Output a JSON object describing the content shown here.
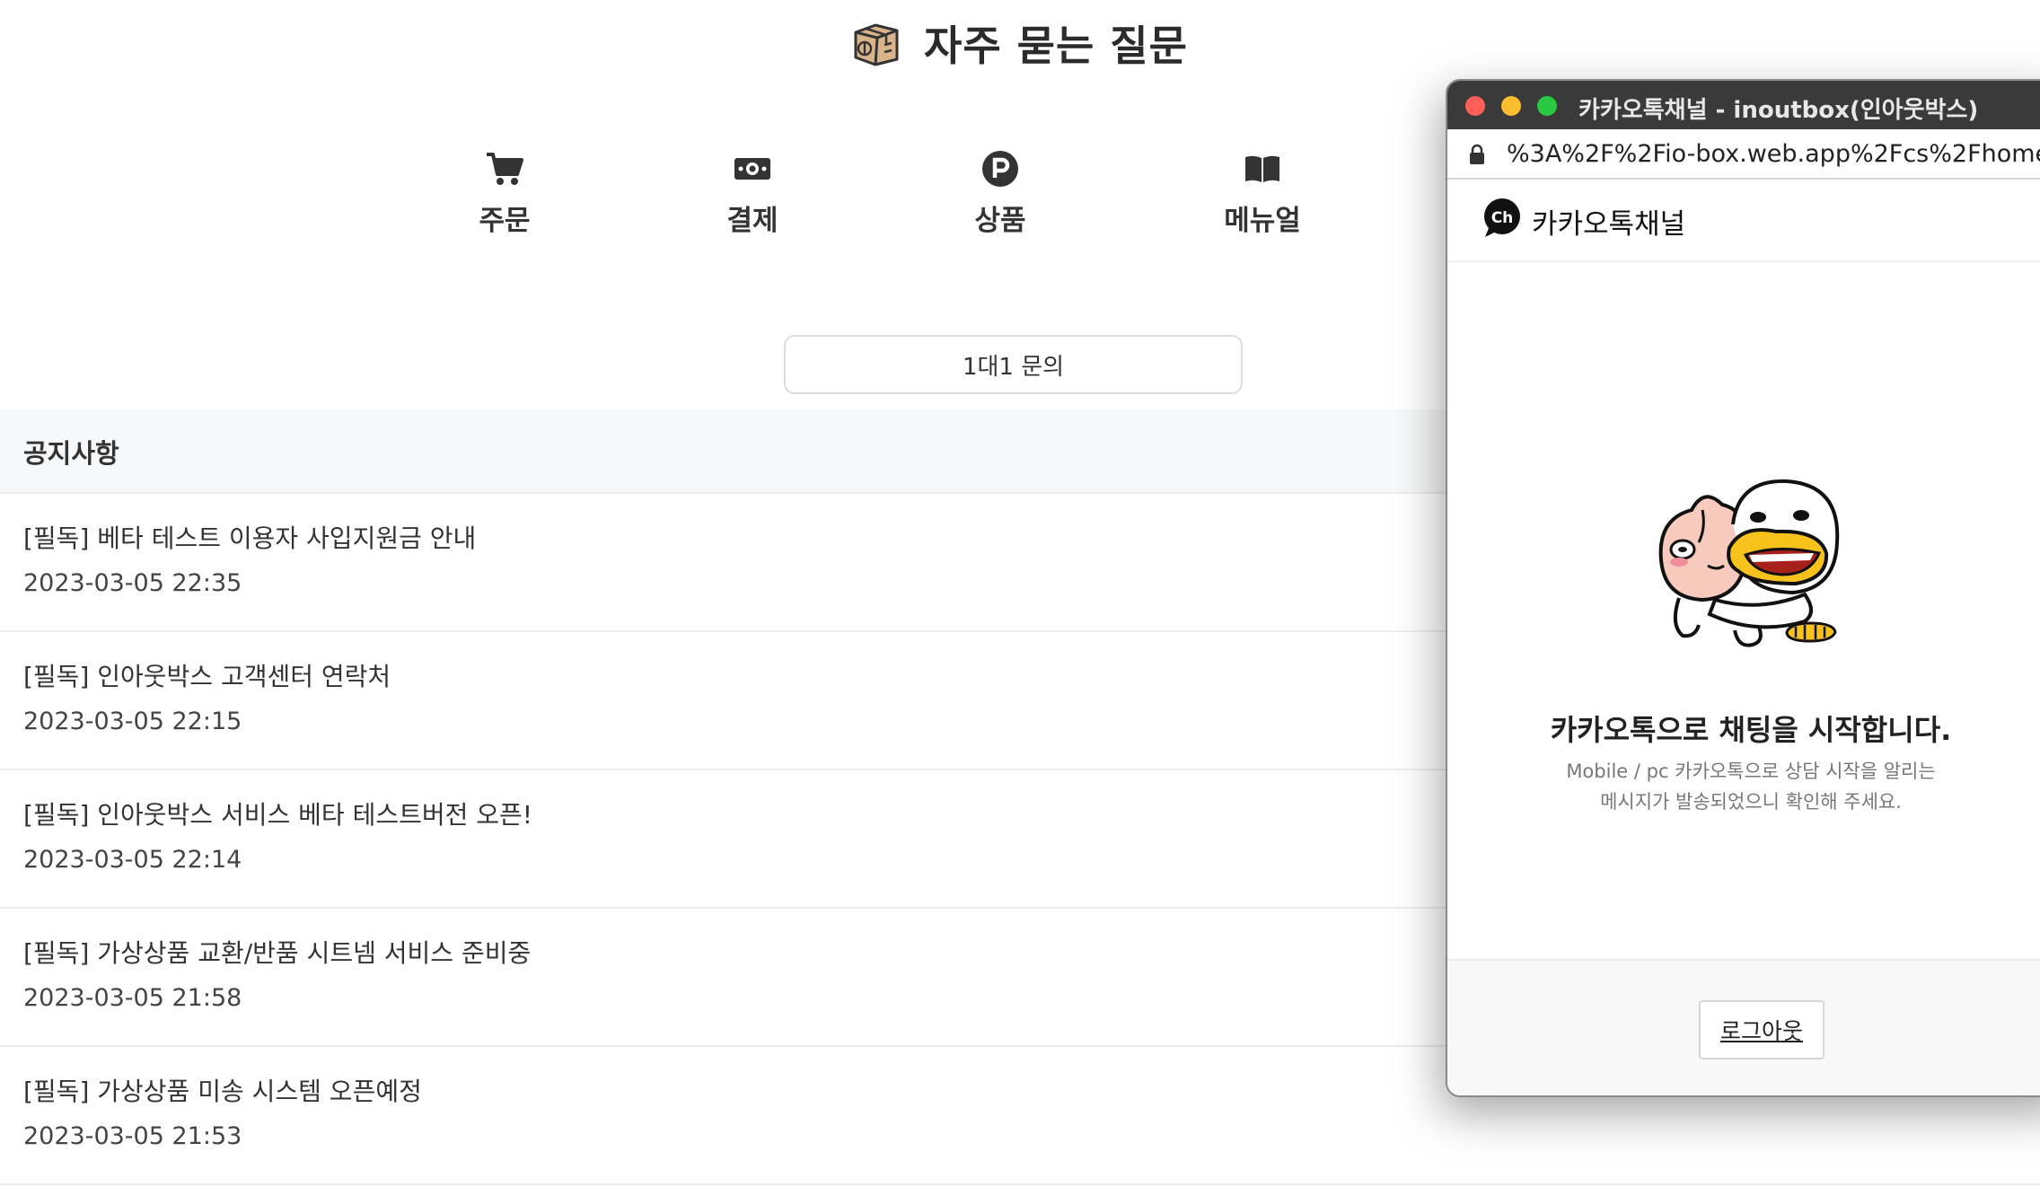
{
  "header": {
    "title": "자주 묻는 질문",
    "logo_icon": "box-icon"
  },
  "categories": [
    {
      "label": "주문",
      "icon": "cart-icon"
    },
    {
      "label": "결제",
      "icon": "money-icon"
    },
    {
      "label": "상품",
      "icon": "p-circle-icon"
    },
    {
      "label": "메뉴얼",
      "icon": "book-icon"
    }
  ],
  "inquiry_button": "1대1 문의",
  "notice": {
    "title": "공지사항",
    "items": [
      {
        "title": "[필독] 베타 테스트 이용자 사입지원금 안내",
        "date": "2023-03-05 22:35"
      },
      {
        "title": "[필독] 인아웃박스 고객센터 연락처",
        "date": "2023-03-05 22:15"
      },
      {
        "title": "[필독] 인아웃박스 서비스 베타 테스트버전 오픈!",
        "date": "2023-03-05 22:14"
      },
      {
        "title": "[필독] 가상상품 교환/반품 시트넴 서비스 준비중",
        "date": "2023-03-05 21:58"
      },
      {
        "title": "[필독] 가상상품 미송 시스템 오픈예정",
        "date": "2023-03-05 21:53"
      }
    ]
  },
  "popup": {
    "window_title": "카카오톡채널 - inoutbox(인아웃박스)",
    "url": "%3A%2F%2Fio-box.web.app%2Fcs%2Fhome",
    "channel_name": "카카오톡채널",
    "channel_logo_text": "Ch",
    "heading": "카카오톡으로 채팅을 시작합니다.",
    "sub_line1": "Mobile / pc 카카오톡으로 상담 시작을 알리는",
    "sub_line2": "메시지가 발송되었으니 확인해 주세요.",
    "logout_label": "로그아웃"
  },
  "colors": {
    "kakao_yellow": "#FEE500",
    "titlebar": "#3a3a3a",
    "notice_bg": "#f7f8f9"
  }
}
